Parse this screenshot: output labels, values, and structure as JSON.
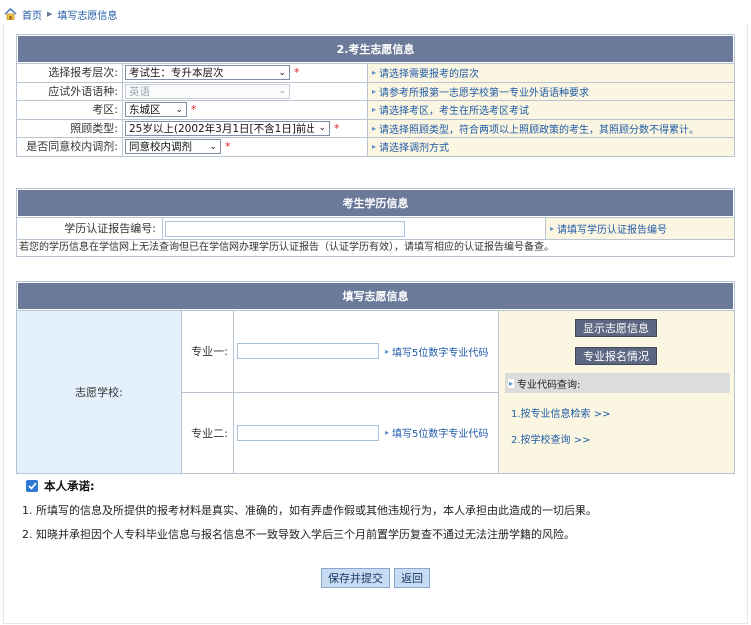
{
  "breadcrumb": {
    "home": "首页",
    "current": "填写志愿信息"
  },
  "volunteer_info": {
    "title": "2.考生志愿信息",
    "rows": [
      {
        "label": "选择报考层次:",
        "value": "考试生：专升本层次",
        "disabled": false,
        "required": true,
        "hint": "请选择需要报考的层次"
      },
      {
        "label": "应试外语语种:",
        "value": "英语",
        "disabled": true,
        "required": false,
        "hint": "请参考所报第一志愿学校第一专业外语语种要求"
      },
      {
        "label": "考区:",
        "value": "东城区",
        "disabled": false,
        "required": true,
        "hint": "请选择考区，考生在所选考区考试"
      },
      {
        "label": "照顾类型:",
        "value": "25岁以上(2002年3月1日[不含1日]前出生",
        "disabled": false,
        "required": true,
        "hint": "请选择照顾类型，符合两项以上照顾政策的考生，其照顾分数不得累计。"
      },
      {
        "label": "是否同意校内调剂:",
        "value": "同意校内调剂",
        "disabled": false,
        "required": true,
        "hint": "请选择调剂方式"
      }
    ]
  },
  "education_info": {
    "title": "考生学历信息",
    "cert_label": "学历认证报告编号:",
    "cert_value": "",
    "cert_hint": "请填写学历认证报告编号",
    "note": "若您的学历信息在学信网上无法查询但已在学信网办理学历认证报告（认证学历有效），请填写相应的认证报告编号备查。"
  },
  "wish_info": {
    "title": "填写志愿信息",
    "school_label": "志愿学校:",
    "majors": [
      {
        "label": "专业一:",
        "value": "",
        "tip": "填写5位数字专业代码"
      },
      {
        "label": "专业二:",
        "value": "",
        "tip": "填写5位数字专业代码"
      }
    ],
    "show_button": "显示志愿信息",
    "enroll_button": "专业报名情况",
    "code_query_title": "专业代码查询:",
    "links": [
      "1.按专业信息检索 >>",
      "2.按学校查询 >>"
    ]
  },
  "pledge": {
    "title": "本人承诺:",
    "checked": true,
    "items": [
      "1. 所填写的信息及所提供的报考材料是真实、准确的，如有弄虚作假或其他违规行为，本人承担由此造成的一切后果。",
      "2. 知晓并承担因个人专科毕业信息与报名信息不一致导致入学后三个月前置学历复查不通过无法注册学籍的风险。"
    ]
  },
  "actions": {
    "submit": "保存并提交",
    "back": "返回"
  },
  "colors": {
    "header_bg": "#6b7a99",
    "hint_bg": "#fbf6e1",
    "link": "#1f5aa6",
    "required": "#e02020"
  }
}
